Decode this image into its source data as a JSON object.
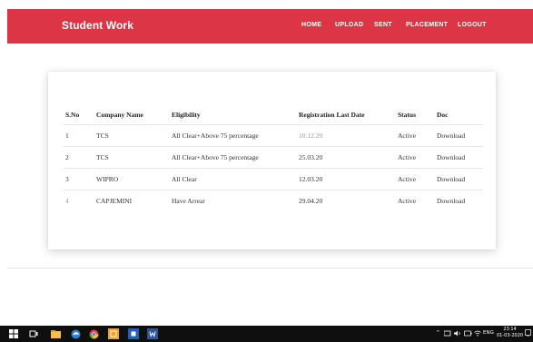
{
  "header": {
    "brand": "Student Work",
    "nav": [
      "HOME",
      "UPLOAD",
      "SENT",
      "PLACEMENT",
      "LOGOUT"
    ]
  },
  "table": {
    "columns": [
      "S.No",
      "Company Name",
      "Eligibility",
      "Registration Last Date",
      "Status",
      "Doc"
    ],
    "rows": [
      [
        "1",
        "TCS",
        "All Clear+Above 75 percentage",
        "10.12.20",
        "Active",
        "Download"
      ],
      [
        "2",
        "TCS",
        "All Clear+Above 75 percentage",
        "25.03.20",
        "Active",
        "Download"
      ],
      [
        "3",
        "WIPRO",
        "All Clear",
        "12.03.20",
        "Active",
        "Download"
      ],
      [
        "4",
        "CAPJEMINI",
        "Have Arrear",
        "29.04.20",
        "Active",
        "Download"
      ]
    ]
  },
  "taskbar": {
    "language": "ENG",
    "time": "23:14",
    "date": "01-03-2020"
  },
  "colors": {
    "header_bg": "#dc3545",
    "taskbar_bg": "#0f0f10"
  }
}
